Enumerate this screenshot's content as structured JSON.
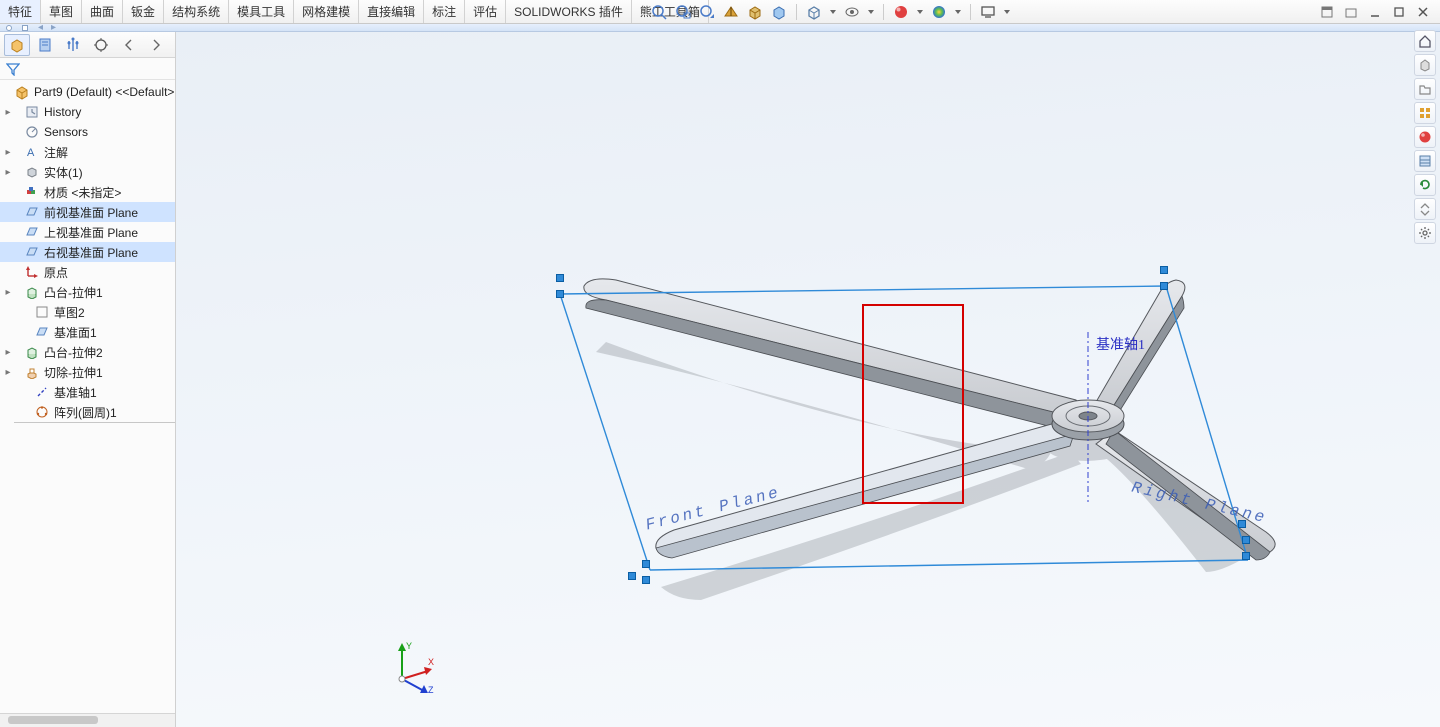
{
  "tabs": {
    "items": [
      "特征",
      "草图",
      "曲面",
      "钣金",
      "结构系统",
      "模具工具",
      "网格建模",
      "直接编辑",
      "标注",
      "评估",
      "SOLIDWORKS 插件",
      "熊工工具箱"
    ],
    "activeIndex": 0
  },
  "breadcrumb": {
    "label": "Front Plane"
  },
  "sidebar": {
    "tabs": [
      "feature-manager",
      "property-manager",
      "configuration-manager",
      "dimxpert-manager",
      "display-manager",
      "more"
    ]
  },
  "tree": {
    "root": "Part9 (Default) <<Default>",
    "items": [
      {
        "indent": 1,
        "tw": "▸",
        "icon": "history-icon",
        "label": "History"
      },
      {
        "indent": 1,
        "tw": "",
        "icon": "sensors-icon",
        "label": "Sensors"
      },
      {
        "indent": 1,
        "tw": "▸",
        "icon": "annotation-icon",
        "label": "注解"
      },
      {
        "indent": 1,
        "tw": "▸",
        "icon": "solid-body-icon",
        "label": "实体(1)"
      },
      {
        "indent": 1,
        "tw": "",
        "icon": "material-icon",
        "label": "材质 <未指定>"
      },
      {
        "indent": 1,
        "tw": "",
        "icon": "plane-icon",
        "label": "前视基准面 Plane",
        "selected": true
      },
      {
        "indent": 1,
        "tw": "",
        "icon": "plane-icon",
        "label": "上视基准面 Plane"
      },
      {
        "indent": 1,
        "tw": "",
        "icon": "plane-icon",
        "label": "右视基准面 Plane",
        "selected": true
      },
      {
        "indent": 1,
        "tw": "",
        "icon": "origin-icon",
        "label": "原点"
      },
      {
        "indent": 1,
        "tw": "▸",
        "icon": "extrude-icon",
        "label": "凸台-拉伸1"
      },
      {
        "indent": 2,
        "tw": "",
        "icon": "sketch-icon",
        "label": "草图2"
      },
      {
        "indent": 2,
        "tw": "",
        "icon": "plane-icon",
        "label": "基准面1"
      },
      {
        "indent": 1,
        "tw": "▸",
        "icon": "extrude-icon",
        "label": "凸台-拉伸2"
      },
      {
        "indent": 1,
        "tw": "▸",
        "icon": "cut-extrude-icon",
        "label": "切除-拉伸1"
      },
      {
        "indent": 2,
        "tw": "",
        "icon": "axis-icon",
        "label": "基准轴1"
      },
      {
        "indent": 2,
        "tw": "",
        "icon": "circular-pattern-icon",
        "label": "阵列(圆周)1"
      }
    ]
  },
  "viewport": {
    "axis_label": "基准轴1",
    "front_plane_label": "Front Plane",
    "right_plane_label": "Right Plane",
    "triad": {
      "x": "X",
      "y": "Y",
      "z": "Z"
    }
  },
  "colors": {
    "selection": "#cfe3ff",
    "plane_outline": "#2f8ad8",
    "redbox": "#d40000",
    "axis_text": "#3a42c8",
    "blade_fill": "#b8bcc2",
    "blade_edge": "#4a4d52",
    "shadow": "#8a8e94"
  }
}
